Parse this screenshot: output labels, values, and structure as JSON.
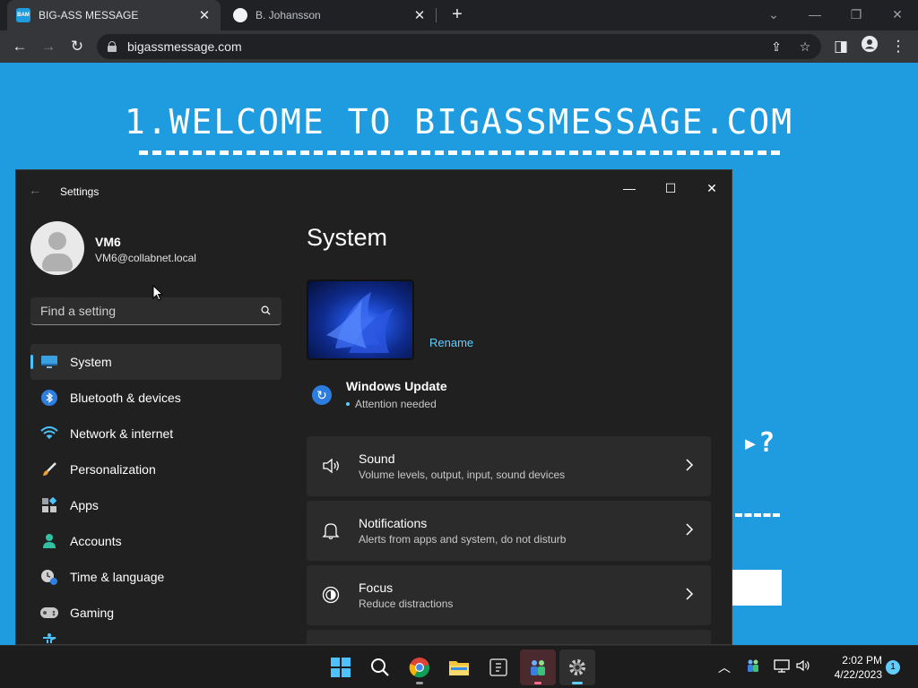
{
  "browser": {
    "tabs": [
      {
        "favicon_text": "BAM",
        "title": "BIG-ASS MESSAGE",
        "active": true
      },
      {
        "favicon_text": "",
        "title": "B. Johansson",
        "active": false
      }
    ],
    "address_bar": {
      "url": "bigassmessage.com"
    }
  },
  "webpage": {
    "heading": "1.WELCOME TO BIGASSMESSAGE.COM",
    "partial_text": "?"
  },
  "settings": {
    "window_title": "Settings",
    "profile": {
      "name": "VM6",
      "email": "VM6@collabnet.local"
    },
    "search": {
      "placeholder": "Find a setting"
    },
    "nav": [
      {
        "label": "System",
        "icon": "system-icon",
        "selected": true
      },
      {
        "label": "Bluetooth & devices",
        "icon": "bluetooth-icon"
      },
      {
        "label": "Network & internet",
        "icon": "network-icon"
      },
      {
        "label": "Personalization",
        "icon": "personalization-icon"
      },
      {
        "label": "Apps",
        "icon": "apps-icon"
      },
      {
        "label": "Accounts",
        "icon": "accounts-icon"
      },
      {
        "label": "Time & language",
        "icon": "time-language-icon"
      },
      {
        "label": "Gaming",
        "icon": "gaming-icon"
      }
    ],
    "main": {
      "title": "System",
      "rename_label": "Rename",
      "windows_update": {
        "title": "Windows Update",
        "status": "Attention needed"
      },
      "cards": [
        {
          "title": "Sound",
          "subtitle": "Volume levels, output, input, sound devices",
          "icon": "sound-icon"
        },
        {
          "title": "Notifications",
          "subtitle": "Alerts from apps and system, do not disturb",
          "icon": "bell-icon"
        },
        {
          "title": "Focus",
          "subtitle": "Reduce distractions",
          "icon": "focus-icon"
        }
      ]
    }
  },
  "taskbar": {
    "time": "2:02 PM",
    "date": "4/22/2023",
    "notification_count": "1"
  },
  "colors": {
    "page_background": "#1f9ce0",
    "settings_background": "#202020",
    "accent": "#60cdff"
  }
}
